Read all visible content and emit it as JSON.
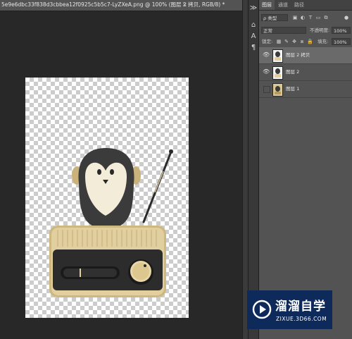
{
  "document_tab": {
    "title": "5e9e6dbc33f838d3cbbea12f0925c5b5c7-LyZXeA.png @ 100% (图层 2 拷贝, RGB/8) *",
    "close": "×"
  },
  "panel": {
    "tabs": [
      {
        "label": "图层",
        "active": true
      },
      {
        "label": "通道",
        "active": false
      },
      {
        "label": "路径",
        "active": false
      }
    ],
    "filter_kind": "ρ 类型",
    "blend_mode": "正常",
    "opacity_label": "不透明度:",
    "opacity_value": "100%",
    "lock_label": "锁定:",
    "fill_label": "填充:",
    "fill_value": "100%",
    "layers": [
      {
        "name": "图层 2 拷贝",
        "visible": true,
        "selected": true
      },
      {
        "name": "图层 2",
        "visible": true,
        "selected": false
      },
      {
        "name": "图层 1",
        "visible": false,
        "selected": false
      }
    ]
  },
  "watermark": {
    "brand": "溜溜自学",
    "url": "ZIXUE.3D66.COM"
  },
  "colors": {
    "panel_bg": "#535353",
    "canvas_bg": "#282828",
    "watermark_bg": "#0d2a5a",
    "radio_body": "#e2cf9f",
    "penguin_body": "#3b3b3b",
    "penguin_face": "#f3ecd9"
  }
}
